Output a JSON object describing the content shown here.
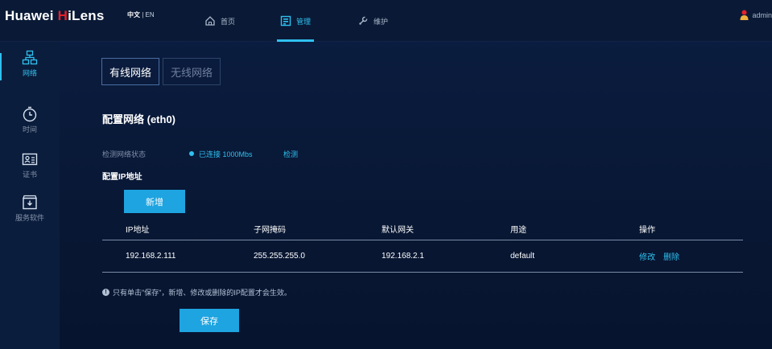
{
  "brand": {
    "prefix": "Huawei ",
    "highlight": "H",
    "rest": "iLens"
  },
  "lang": {
    "zh": "中文",
    "sep": " | ",
    "en": "EN"
  },
  "nav": [
    {
      "label": "首页",
      "icon": "home-icon",
      "active": false
    },
    {
      "label": "管理",
      "icon": "manage-icon",
      "active": true
    },
    {
      "label": "维护",
      "icon": "wrench-icon",
      "active": false
    }
  ],
  "user": {
    "name": "admin"
  },
  "sidebar": {
    "items": [
      {
        "label": "网络",
        "icon": "network-icon",
        "active": true
      },
      {
        "label": "时间",
        "icon": "clock-icon",
        "active": false
      },
      {
        "label": "证书",
        "icon": "certificate-icon",
        "active": false
      },
      {
        "label": "服务软件",
        "icon": "software-package-icon",
        "active": false
      }
    ]
  },
  "tabs": [
    {
      "label": "有线网络",
      "active": true
    },
    {
      "label": "无线网络",
      "active": false
    }
  ],
  "section_title": "配置网络 (eth0)",
  "status": {
    "label": "检测网络状态",
    "value": "已连接 1000Mbs",
    "detect": "检测"
  },
  "config_ip_label": "配置IP地址",
  "add_button": "新增",
  "table": {
    "headers": [
      "IP地址",
      "子网掩码",
      "默认网关",
      "用途",
      "操作"
    ],
    "rows": [
      {
        "ip": "192.168.2.111",
        "mask": "255.255.255.0",
        "gateway": "192.168.2.1",
        "usage": "default",
        "edit": "修改",
        "delete": "删除"
      }
    ]
  },
  "hint": "只有单击\"保存\"，新增、修改或删除的IP配置才会生效。",
  "save_button": "保存",
  "colors": {
    "accent": "#2fc0f0",
    "button": "#1ea4e0",
    "brand_red": "#e8202a",
    "background": "#07142e"
  }
}
